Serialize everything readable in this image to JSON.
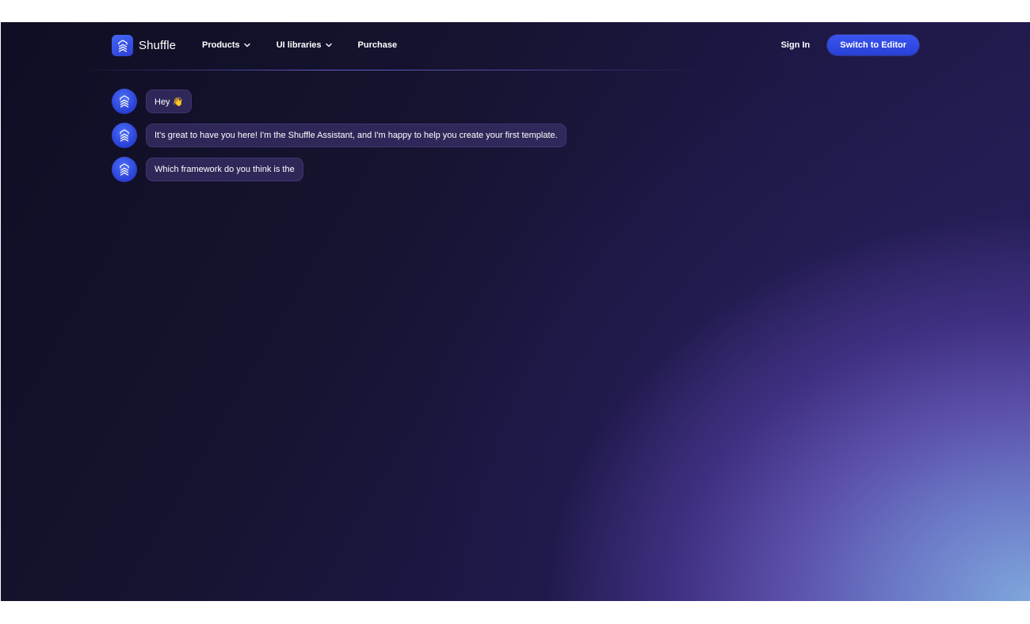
{
  "brand": {
    "name": "Shuffle",
    "logo_icon": "shuffle-logo-icon",
    "accent": "#3a55f0"
  },
  "nav": {
    "items": [
      {
        "label": "Products",
        "has_dropdown": true
      },
      {
        "label": "UI libraries",
        "has_dropdown": true
      },
      {
        "label": "Purchase",
        "has_dropdown": false
      }
    ],
    "sign_in": "Sign In",
    "editor_button": "Switch to Editor"
  },
  "chat": {
    "messages": [
      {
        "text": "Hey 👋"
      },
      {
        "text": "It's great to have you here! I'm the Shuffle Assistant, and I'm happy to help you create your first template."
      },
      {
        "text": "Which framework do you think is the"
      }
    ]
  }
}
